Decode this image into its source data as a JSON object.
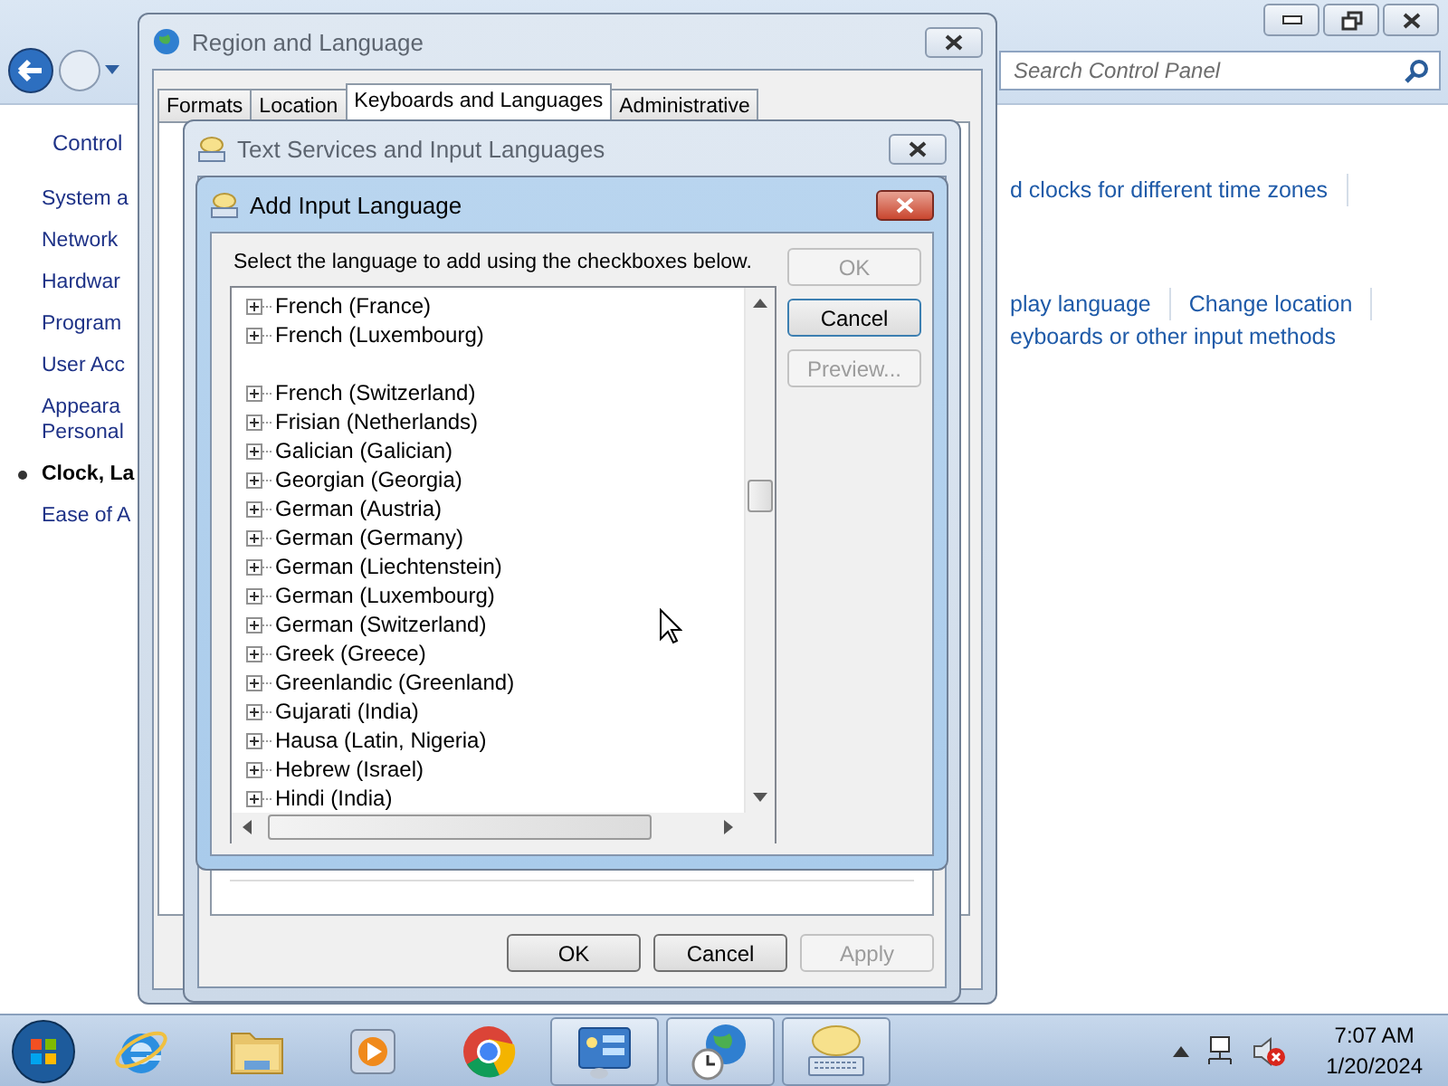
{
  "control_panel": {
    "window_buttons": [
      {
        "kind": "minimize"
      },
      {
        "kind": "restore"
      },
      {
        "kind": "close"
      }
    ],
    "search": {
      "placeholder": "Search Control Panel"
    },
    "sidebar": {
      "header": "Control",
      "items": [
        {
          "label": "System a",
          "selected": false
        },
        {
          "label": "Network",
          "selected": false
        },
        {
          "label": "Hardwar",
          "selected": false
        },
        {
          "label": "Program",
          "selected": false
        },
        {
          "label": "User Acc",
          "selected": false
        },
        {
          "label": "Appeara\nPersonal",
          "selected": false
        },
        {
          "label": "Clock, La",
          "selected": true
        },
        {
          "label": "Ease of A",
          "selected": false
        }
      ]
    },
    "task_links": [
      {
        "divider": true,
        "items": [
          "d clocks for different time zones"
        ]
      },
      {
        "divider": true,
        "items": [
          "play language",
          "Change location"
        ]
      },
      {
        "divider": false,
        "items": [
          "eyboards or other input methods"
        ]
      }
    ]
  },
  "region_window": {
    "title": "Region and Language",
    "tabs": [
      {
        "label": "Formats",
        "selected": false
      },
      {
        "label": "Location",
        "selected": false
      },
      {
        "label": "Keyboards and Languages",
        "selected": true
      },
      {
        "label": "Administrative",
        "selected": false
      }
    ]
  },
  "text_services_window": {
    "title": "Text Services and Input Languages",
    "buttons": [
      {
        "label": "OK",
        "disabled": false
      },
      {
        "label": "Cancel",
        "disabled": false
      },
      {
        "label": "Apply",
        "disabled": true
      }
    ]
  },
  "add_language_dialog": {
    "title": "Add Input Language",
    "instruction": "Select the language to add using the checkboxes below.",
    "languages": [
      {
        "kind": "language",
        "label": "French (France)",
        "expanded": false
      },
      {
        "kind": "language",
        "label": "French (Luxembourg)",
        "expanded": false
      },
      {
        "kind": "blank"
      },
      {
        "kind": "language",
        "label": "French (Switzerland)",
        "expanded": false
      },
      {
        "kind": "language",
        "label": "Frisian (Netherlands)",
        "expanded": false
      },
      {
        "kind": "language",
        "label": "Galician (Galician)",
        "expanded": false
      },
      {
        "kind": "language",
        "label": "Georgian (Georgia)",
        "expanded": false
      },
      {
        "kind": "language",
        "label": "German (Austria)",
        "expanded": false
      },
      {
        "kind": "language",
        "label": "German (Germany)",
        "expanded": false
      },
      {
        "kind": "language",
        "label": "German (Liechtenstein)",
        "expanded": false
      },
      {
        "kind": "language",
        "label": "German (Luxembourg)",
        "expanded": false
      },
      {
        "kind": "language",
        "label": "German (Switzerland)",
        "expanded": false
      },
      {
        "kind": "language",
        "label": "Greek (Greece)",
        "expanded": false
      },
      {
        "kind": "language",
        "label": "Greenlandic (Greenland)",
        "expanded": false
      },
      {
        "kind": "language",
        "label": "Gujarati (India)",
        "expanded": false
      },
      {
        "kind": "language",
        "label": "Hausa (Latin, Nigeria)",
        "expanded": false
      },
      {
        "kind": "language",
        "label": "Hebrew (Israel)",
        "expanded": false
      },
      {
        "kind": "language",
        "label": "Hindi (India)",
        "expanded": false
      }
    ],
    "buttons": [
      {
        "label": "OK",
        "disabled": true,
        "default": false
      },
      {
        "label": "Cancel",
        "disabled": false,
        "default": true
      },
      {
        "label": "Preview...",
        "disabled": true,
        "default": false
      }
    ]
  },
  "taskbar": {
    "apps": [
      {
        "kind": "browser-e",
        "active": false
      },
      {
        "kind": "folder",
        "active": false
      },
      {
        "kind": "media",
        "active": false
      },
      {
        "kind": "chrome",
        "active": false
      },
      {
        "kind": "control-panel",
        "active": true
      },
      {
        "kind": "globe-clock",
        "active": true
      },
      {
        "kind": "keyboard-bubble",
        "active": true
      }
    ],
    "tray": {
      "time": "7:07 AM",
      "date": "1/20/2024"
    }
  }
}
